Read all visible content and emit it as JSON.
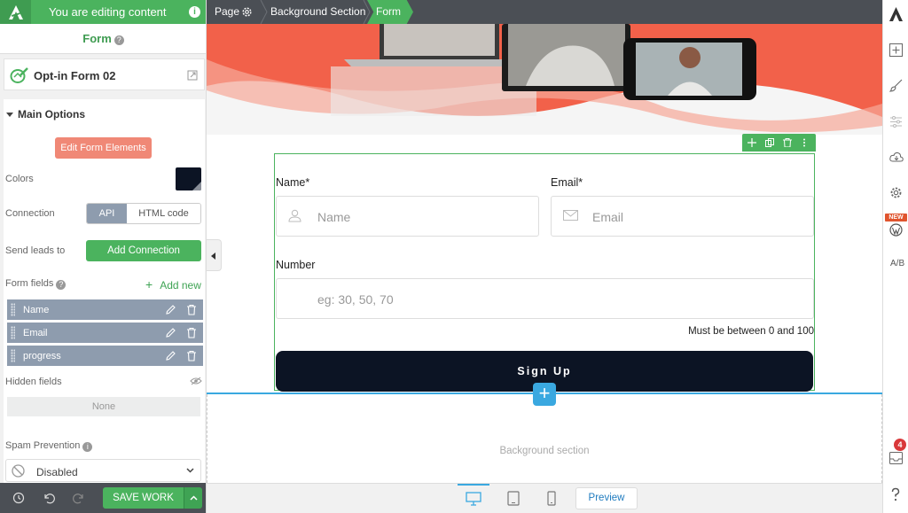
{
  "topbar": {
    "editing_label": "You are editing content",
    "info_icon": "info-icon"
  },
  "panel": {
    "title": "Form",
    "help": "?",
    "template_name": "Opt-in Form 02",
    "section_title": "Main Options",
    "edit_form_elements": "Edit Form Elements",
    "colors_label": "Colors",
    "colors_value": "#0c1424",
    "connection_label": "Connection",
    "connection_options": [
      "API",
      "HTML code"
    ],
    "connection_selected": "API",
    "send_leads_label": "Send leads to",
    "add_connection": "Add Connection",
    "form_fields_label": "Form fields",
    "add_new": "Add new",
    "fields": [
      {
        "name": "Name"
      },
      {
        "name": "Email"
      },
      {
        "name": "progress"
      }
    ],
    "hidden_fields_label": "Hidden fields",
    "hidden_fields_value": "None",
    "spam_label": "Spam Prevention",
    "spam_value": "Disabled"
  },
  "bottombar": {
    "save_label": "SAVE WORK"
  },
  "breadcrumb": {
    "items": [
      "Page",
      "Background Section",
      "Form"
    ]
  },
  "form": {
    "name_label": "Name*",
    "name_placeholder": "Name",
    "email_label": "Email*",
    "email_placeholder": "Email",
    "number_label": "Number",
    "number_placeholder": "eg: 30, 50, 70",
    "number_helper": "Must be between 0 and 100",
    "submit_label": "Sign Up"
  },
  "canvas": {
    "background_section_label": "Background section"
  },
  "devicebar": {
    "devices": [
      "desktop-icon",
      "tablet-icon",
      "mobile-icon"
    ],
    "active": "desktop",
    "preview_label": "Preview"
  },
  "rightrail": {
    "new_badge": "NEW",
    "notification_count": "4",
    "ab_label": "A/B"
  },
  "colors": {
    "brand_green": "#4bb35e",
    "dark_bar": "#4b4f55",
    "button_dark": "#0c1424",
    "accent_blue": "#3aa8e0",
    "edit_button": "#f08876",
    "field_row": "#8e9cae"
  }
}
